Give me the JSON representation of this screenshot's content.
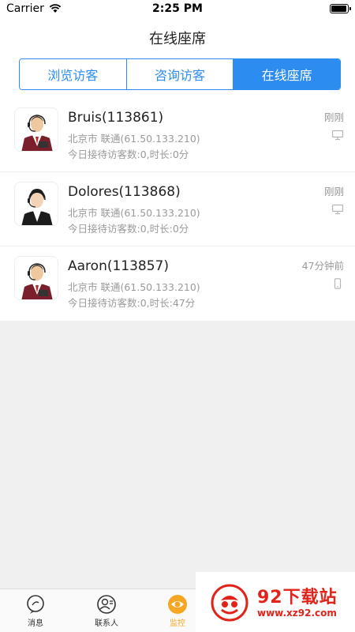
{
  "status_bar": {
    "carrier": "Carrier",
    "time": "2:25 PM"
  },
  "nav": {
    "title": "在线座席"
  },
  "segments": [
    {
      "label": "浏览访客",
      "active": false
    },
    {
      "label": "咨询访客",
      "active": false
    },
    {
      "label": "在线座席",
      "active": true
    }
  ],
  "agents": [
    {
      "name": "Bruis(113861)",
      "location": "北京市 联通(61.50.133.210)",
      "stats": "今日接待访客数:0,时长:0分",
      "time": "刚刚",
      "device": "desktop-icon",
      "avatar": "male-agent-avatar"
    },
    {
      "name": "Dolores(113868)",
      "location": "北京市 联通(61.50.133.210)",
      "stats": "今日接待访客数:0,时长:0分",
      "time": "刚刚",
      "device": "desktop-icon",
      "avatar": "female-agent-avatar"
    },
    {
      "name": "Aaron(113857)",
      "location": "北京市 联通(61.50.133.210)",
      "stats": "今日接待访客数:0,时长:47分",
      "time": "47分钟前",
      "device": "mobile-icon",
      "avatar": "male-agent-avatar"
    }
  ],
  "tabbar": [
    {
      "label": "消息",
      "icon": "message-icon",
      "active": false
    },
    {
      "label": "联系人",
      "icon": "contacts-icon",
      "active": false
    },
    {
      "label": "监控",
      "icon": "monitor-eye-icon",
      "active": true
    }
  ],
  "watermark": {
    "title": "92下载站",
    "url": "www.xz92.com"
  },
  "colors": {
    "accent": "#2d8cf0",
    "tab_active": "#f5a623",
    "watermark": "#e2231a"
  }
}
